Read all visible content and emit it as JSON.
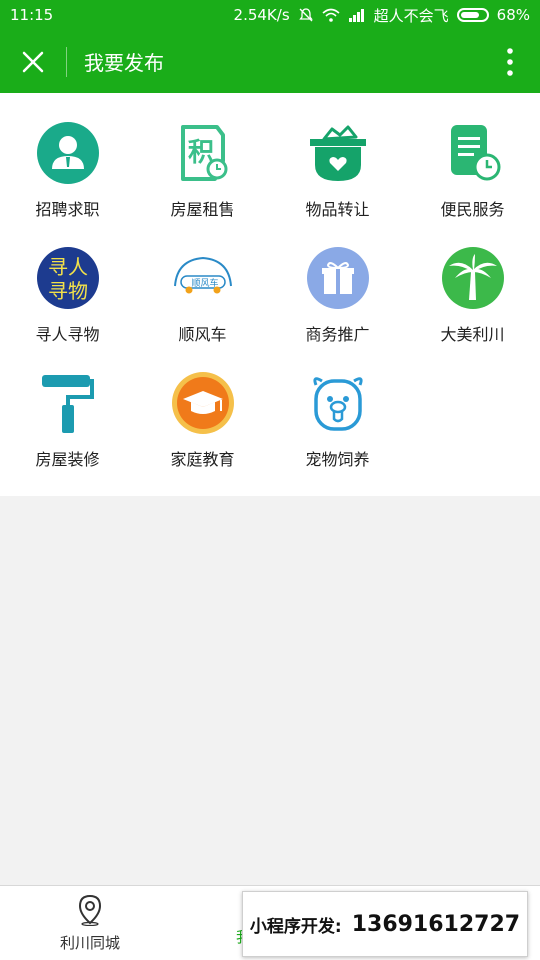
{
  "status_bar": {
    "time": "11:15",
    "speed": "2.54K/s",
    "carrier": "超人不会飞",
    "battery": "68%"
  },
  "header": {
    "title": "我要发布"
  },
  "categories": [
    {
      "label": "招聘求职",
      "icon": "job-seeker-icon",
      "color": "#1aaa8a"
    },
    {
      "label": "房屋租售",
      "icon": "house-rent-icon",
      "color": "#3bbf8a"
    },
    {
      "label": "物品转让",
      "icon": "item-transfer-icon",
      "color": "#15a36a"
    },
    {
      "label": "便民服务",
      "icon": "service-icon",
      "color": "#2bb673"
    },
    {
      "label": "寻人寻物",
      "icon": "lost-found-icon",
      "icon_text": "寻人\n寻物",
      "color": "#1d3b8f"
    },
    {
      "label": "顺风车",
      "icon": "carpool-icon",
      "icon_text": "顺风车",
      "color": "#2a8ac7"
    },
    {
      "label": "商务推广",
      "icon": "gift-icon",
      "color": "#8aa9e6"
    },
    {
      "label": "大美利川",
      "icon": "palm-tree-icon",
      "color": "#3cb94a"
    },
    {
      "label": "房屋装修",
      "icon": "paint-roller-icon",
      "color": "#1c9bb0"
    },
    {
      "label": "家庭教育",
      "icon": "graduation-cap-icon",
      "color": "#f07a1a"
    },
    {
      "label": "宠物饲养",
      "icon": "pet-icon",
      "color": "#2a9ad6"
    }
  ],
  "bottom_nav": {
    "home_label": "利川同城",
    "publish_label_partial": "我"
  },
  "ad": {
    "label": "小程序开发:",
    "phone": "13691612727"
  }
}
